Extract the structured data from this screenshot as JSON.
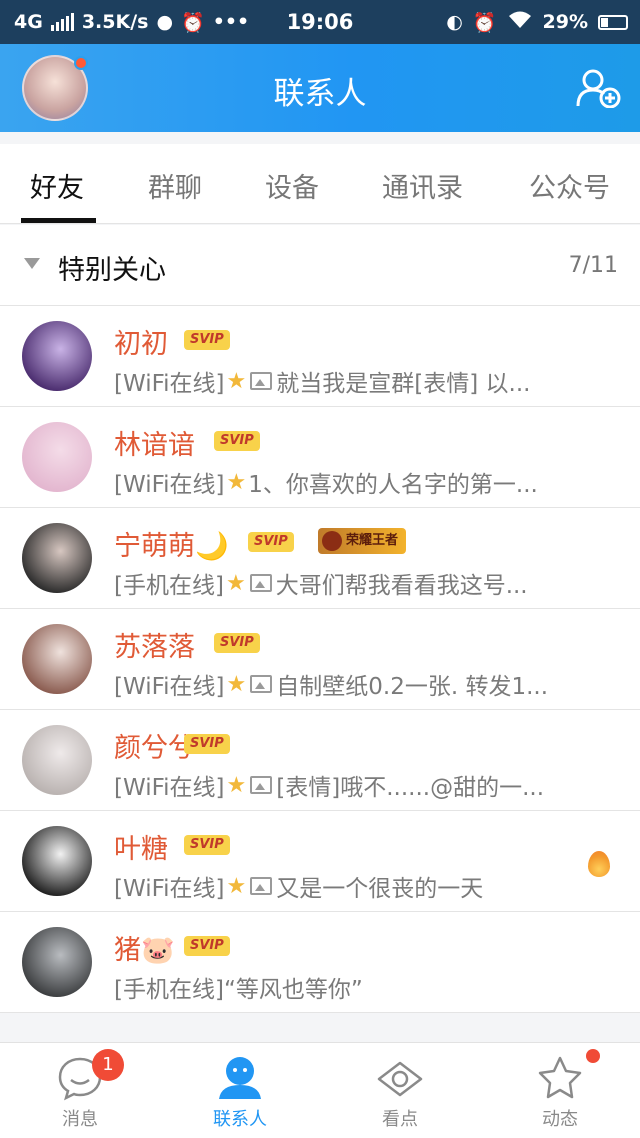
{
  "statusbar": {
    "network": "4G",
    "speed": "3.5K/s",
    "time": "19:06",
    "battery": "29%"
  },
  "header": {
    "title": "联系人"
  },
  "tabs": [
    {
      "label": "好友",
      "active": true
    },
    {
      "label": "群聊",
      "active": false
    },
    {
      "label": "设备",
      "active": false
    },
    {
      "label": "通讯录",
      "active": false
    },
    {
      "label": "公众号",
      "active": false
    }
  ],
  "group": {
    "name": "特别关心",
    "count": "7/11"
  },
  "contacts": [
    {
      "name": "初初",
      "badge": "SVIP",
      "status": "[WiFi在线]",
      "message": "就当我是宣群[表情] 以...",
      "has_image": true,
      "avatar_colors": [
        "#4a2c6e",
        "#c9b3e6"
      ]
    },
    {
      "name": "林谙谙",
      "badge": "SVIP",
      "status": "[WiFi在线]",
      "message": "1、你喜欢的人名字的第一...",
      "has_image": false,
      "avatar_colors": [
        "#e3b6cf",
        "#f4dce8"
      ]
    },
    {
      "name": "宁萌萌🌙",
      "badge": "SVIP",
      "badge2": "荣耀王者",
      "status": "[手机在线]",
      "message": "大哥们帮我看看我这号...",
      "has_image": true,
      "avatar_colors": [
        "#2b2b2b",
        "#d7c7c1"
      ]
    },
    {
      "name": "苏落落",
      "badge": "SVIP",
      "status": "[WiFi在线]",
      "message": "自制壁纸0.2一张. 转发1...",
      "has_image": true,
      "avatar_colors": [
        "#8a5b4f",
        "#efe2dd"
      ]
    },
    {
      "name": "颜兮兮",
      "badge": "SVIP",
      "status": "[WiFi在线]",
      "message": "[表情]哦不......@甜的一...",
      "has_image": true,
      "avatar_colors": [
        "#b9b2b0",
        "#efeaea"
      ]
    },
    {
      "name": "叶糖",
      "badge": "SVIP",
      "status": "[WiFi在线]",
      "message": "又是一个很丧的一天",
      "has_image": true,
      "fire": true,
      "avatar_colors": [
        "#1f1f1f",
        "#f2f2f2"
      ]
    },
    {
      "name": "猪🐷",
      "badge": "SVIP",
      "status": "[手机在线]",
      "message": "“等风也等你”",
      "has_image": false,
      "no_star": true,
      "avatar_colors": [
        "#3b3d3f",
        "#b9bcc0"
      ]
    }
  ],
  "bottomnav": [
    {
      "label": "消息",
      "icon": "message-icon",
      "badge": "1",
      "active": false
    },
    {
      "label": "联系人",
      "icon": "contacts-icon",
      "active": true
    },
    {
      "label": "看点",
      "icon": "eye-icon",
      "active": false
    },
    {
      "label": "动态",
      "icon": "star-icon",
      "dot": true,
      "active": false
    }
  ],
  "colors": {
    "accent": "#2196f3",
    "name": "#e05a36",
    "svip_bg": "#f8d24a"
  }
}
